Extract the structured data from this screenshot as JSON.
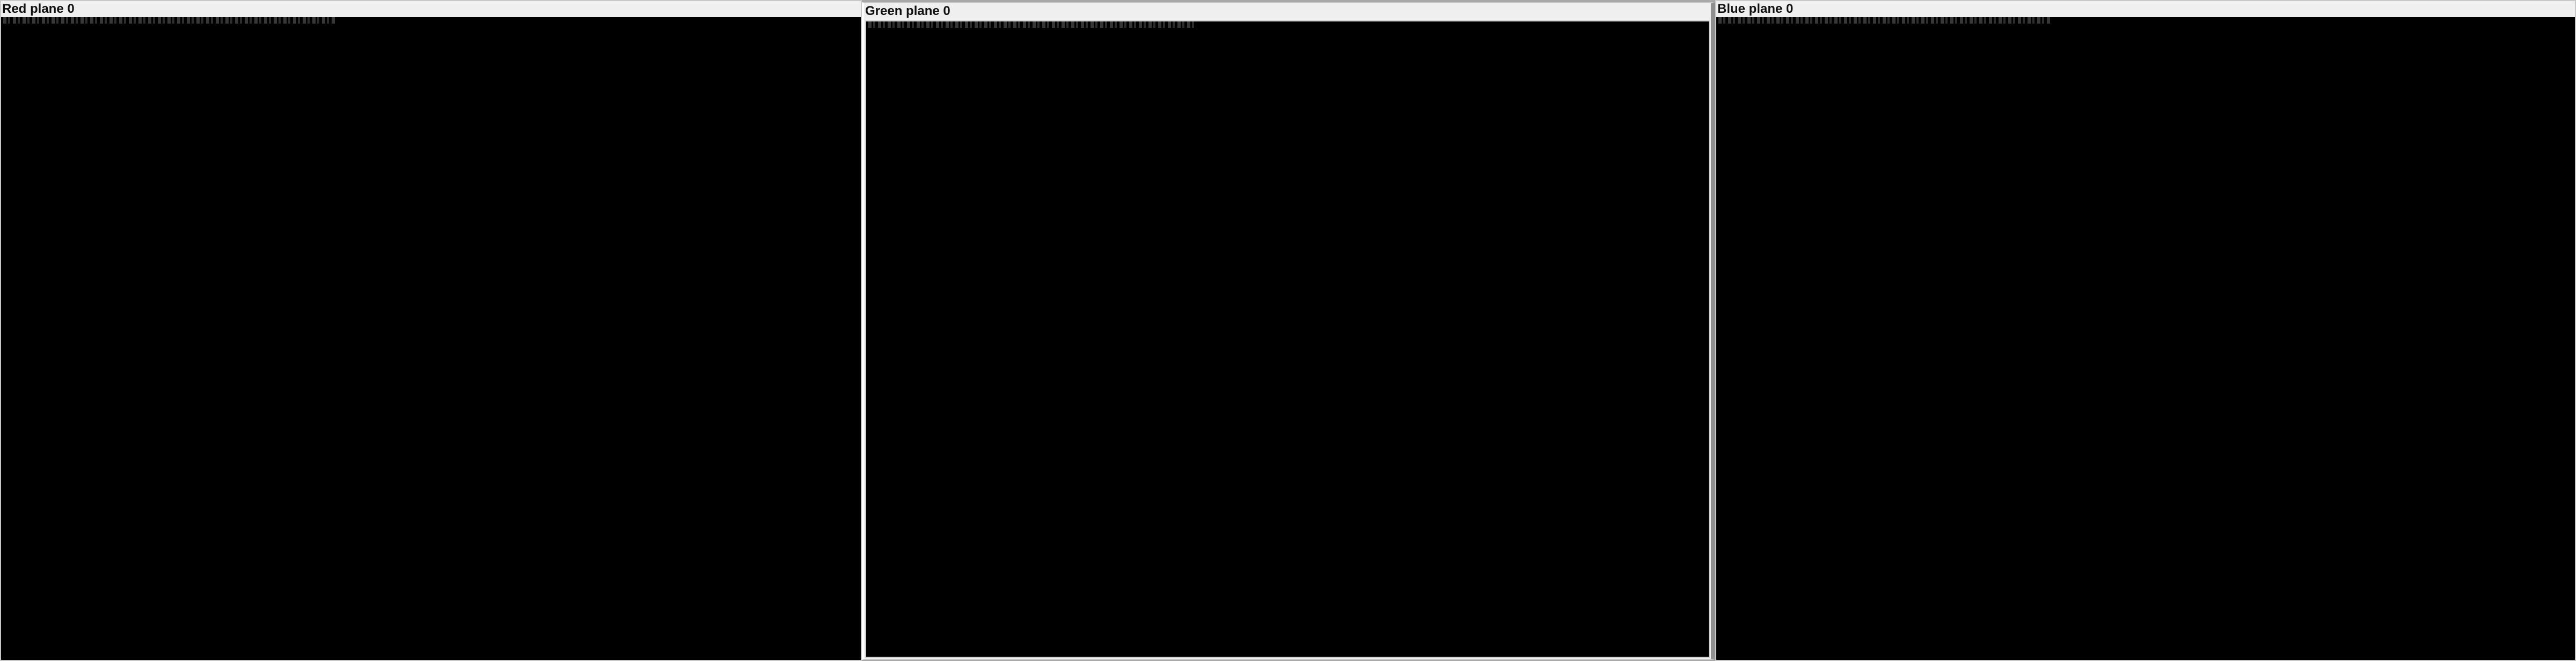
{
  "panels": [
    {
      "id": "red",
      "title": "Red plane 0",
      "accent": "#ff0000"
    },
    {
      "id": "green",
      "title": "Green plane 0",
      "accent": "#00ff00"
    },
    {
      "id": "blue",
      "title": "Blue plane 0",
      "accent": "#0000ff"
    }
  ],
  "colors": {
    "panel_background": "#efefef",
    "view_background": "#000000",
    "title_text": "#111111"
  }
}
